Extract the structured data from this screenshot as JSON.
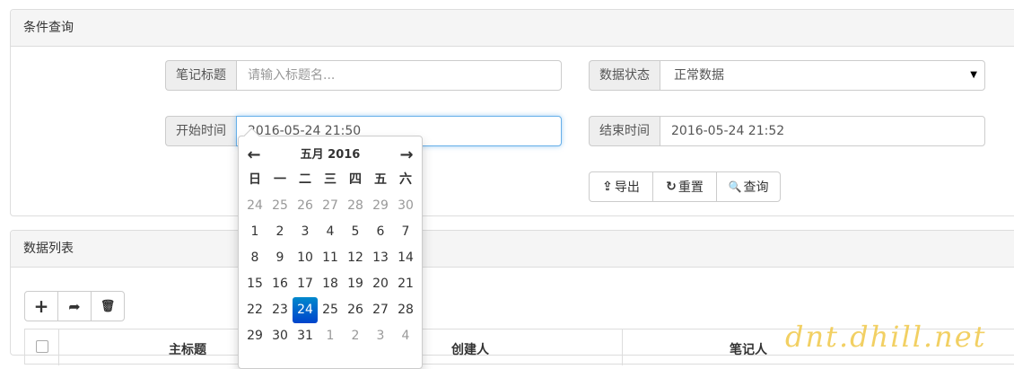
{
  "query_panel": {
    "title": "条件查询",
    "note_title_label": "笔记标题",
    "note_title_placeholder": "请输入标题名...",
    "status_label": "数据状态",
    "status_value": "正常数据",
    "start_label": "开始时间",
    "start_value": "2016-05-24 21:50",
    "end_label": "结束时间",
    "end_value": "2016-05-24 21:52",
    "export_label": "导出",
    "reset_label": "重置",
    "search_label": "查询"
  },
  "datepicker": {
    "title": "五月 2016",
    "prev_icon": "←",
    "next_icon": "→",
    "weekdays": [
      "日",
      "一",
      "二",
      "三",
      "四",
      "五",
      "六"
    ],
    "weeks": [
      [
        {
          "d": "24",
          "old": true
        },
        {
          "d": "25",
          "old": true
        },
        {
          "d": "26",
          "old": true
        },
        {
          "d": "27",
          "old": true
        },
        {
          "d": "28",
          "old": true
        },
        {
          "d": "29",
          "old": true
        },
        {
          "d": "30",
          "old": true
        }
      ],
      [
        {
          "d": "1"
        },
        {
          "d": "2"
        },
        {
          "d": "3"
        },
        {
          "d": "4"
        },
        {
          "d": "5"
        },
        {
          "d": "6"
        },
        {
          "d": "7"
        }
      ],
      [
        {
          "d": "8"
        },
        {
          "d": "9"
        },
        {
          "d": "10"
        },
        {
          "d": "11"
        },
        {
          "d": "12"
        },
        {
          "d": "13"
        },
        {
          "d": "14"
        }
      ],
      [
        {
          "d": "15"
        },
        {
          "d": "16"
        },
        {
          "d": "17"
        },
        {
          "d": "18"
        },
        {
          "d": "19"
        },
        {
          "d": "20"
        },
        {
          "d": "21"
        }
      ],
      [
        {
          "d": "22"
        },
        {
          "d": "23"
        },
        {
          "d": "24",
          "active": true
        },
        {
          "d": "25"
        },
        {
          "d": "26"
        },
        {
          "d": "27"
        },
        {
          "d": "28"
        }
      ],
      [
        {
          "d": "29"
        },
        {
          "d": "30"
        },
        {
          "d": "31"
        },
        {
          "d": "1",
          "old": true
        },
        {
          "d": "2",
          "old": true
        },
        {
          "d": "3",
          "old": true
        },
        {
          "d": "4",
          "old": true
        }
      ]
    ]
  },
  "list_panel": {
    "title": "数据列表",
    "add_icon": "+",
    "share_icon": "➦",
    "delete_icon": "🗑",
    "columns": [
      "主标题",
      "创建人",
      "笔记人"
    ]
  },
  "icons": {
    "export": "⇪",
    "reset": "↻",
    "search": "🔍",
    "status_caret": "▼"
  },
  "watermark": "dnt.dhill.net"
}
